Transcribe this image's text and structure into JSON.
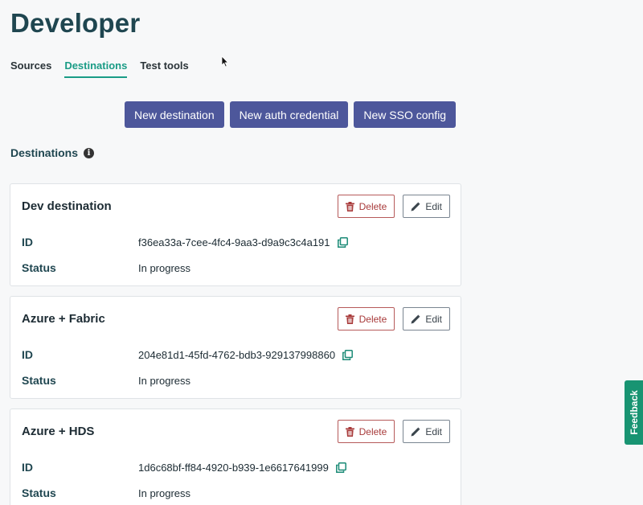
{
  "page": {
    "title": "Developer"
  },
  "tabs": [
    {
      "label": "Sources",
      "active": false
    },
    {
      "label": "Destinations",
      "active": true
    },
    {
      "label": "Test tools",
      "active": false
    }
  ],
  "actions": {
    "new_destination": "New destination",
    "new_auth_credential": "New auth credential",
    "new_sso_config": "New SSO config"
  },
  "section": {
    "title": "Destinations",
    "info_icon": "i"
  },
  "labels": {
    "id": "ID",
    "status": "Status",
    "delete": "Delete",
    "edit": "Edit"
  },
  "destinations": [
    {
      "name": "Dev destination",
      "id": "f36ea33a-7cee-4fc4-9aa3-d9a9c3c4a191",
      "status": "In progress"
    },
    {
      "name": "Azure + Fabric",
      "id": "204e81d1-45fd-4762-bdb3-929137998860",
      "status": "In progress"
    },
    {
      "name": "Azure + HDS",
      "id": "1d6c68bf-ff84-4920-b939-1e6617641999",
      "status": "In progress"
    }
  ],
  "feedback": {
    "label": "Feedback"
  },
  "colors": {
    "accent": "#1a9c86",
    "primary_button": "#4d579b",
    "delete": "#a83a3a",
    "feedback_tab": "#189472",
    "title": "#1f4650"
  },
  "icons": {
    "delete": "trash-icon",
    "edit": "pencil-icon",
    "copy": "copy-icon",
    "info": "info-icon",
    "cursor": "mouse-cursor-icon"
  }
}
